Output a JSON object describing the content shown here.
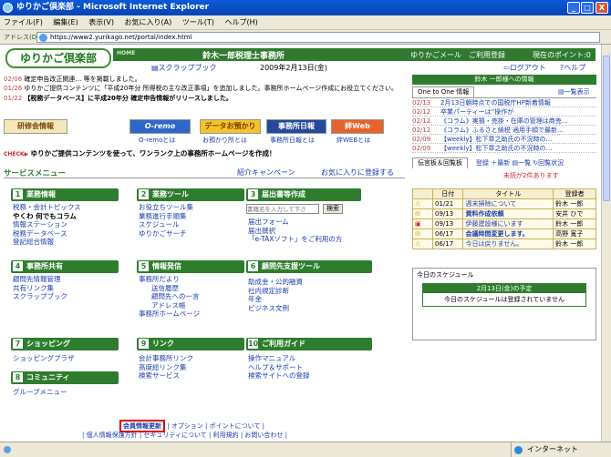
{
  "window": {
    "title": "ゆりかご倶楽部 - Microsoft Internet Explorer",
    "min": "_",
    "max": "□",
    "close": "X"
  },
  "menu": [
    "ファイル(F)",
    "編集(E)",
    "表示(V)",
    "お気に入り(A)",
    "ツール(T)",
    "ヘルプ(H)"
  ],
  "address": {
    "label": "アドレス(D)",
    "url": "https://www2.yurikago.net/portal/index.html"
  },
  "header": {
    "logo": "ゆりかご倶楽部",
    "home": "HOME",
    "office": "鈴木一郎税理士事務所",
    "mail": "ゆりかごメール",
    "entry": "ご利用登録",
    "points": "現在のポイント:0",
    "scrapbook": "スクラップブック",
    "date": "2009年2月13日(金)",
    "logout": "ログアウト",
    "help": "ヘルプ"
  },
  "news": [
    {
      "date": "02/06",
      "text": "確定申告改正関連… 等を掲載しました。"
    },
    {
      "date": "01/26",
      "text": "ゆりかご提供コンテンツに「平成20年分 所得税の主な改正事項」を追加しました。事務所ホームページ作成にお役立てください。"
    },
    {
      "date": "01/22",
      "text": "【税務データベース】に平成20年分 確定申告情報がリリースしました。"
    }
  ],
  "banners": [
    {
      "label": "研修会情報",
      "sub": ""
    },
    {
      "label": "O-remo",
      "sub": "O-remoとは"
    },
    {
      "label": "データお預かり",
      "sub": "お預かり所とは"
    },
    {
      "label": "事務所日報",
      "sub": "事務所日報とは"
    },
    {
      "label": "絆Web",
      "sub": "絆WEBとは"
    }
  ],
  "check_text": "ゆりかご提供コンテンツを使って、ワンランク上の事務所ホームページを作成！",
  "service": {
    "title": "サービスメニュー",
    "campaign": "紹介キャンペーン",
    "favorite": "お気に入りに登録する"
  },
  "categories": [
    {
      "num": "1",
      "title": "業務情報",
      "items": [
        "税務・会計トピックス",
        "やくわ 何でもコラム",
        "情報ステーション",
        "税務データベース",
        "登記総合情報"
      ]
    },
    {
      "num": "2",
      "title": "業務ツール",
      "items": [
        "お役立ちツール集",
        "業務進行手順集",
        "スケジュール",
        "ゆりかごサーチ"
      ]
    },
    {
      "num": "3",
      "title": "届出書等作成",
      "items": [
        "届出フォーム",
        "届出撰択",
        "「e-TAXソフト」をご利用の方"
      ],
      "search_placeholder": "書籍名を入力して下さ",
      "search_button": "検索"
    },
    {
      "num": "4",
      "title": "事務所共有",
      "items": [
        "顧問先情報管理",
        "共有リンク集",
        "スクラップブック"
      ]
    },
    {
      "num": "5",
      "title": "情報発信",
      "items": [
        "事務所だより",
        "送信履歴",
        "顧問先への一言",
        "アドレス帳",
        "事務所ホームページ"
      ]
    },
    {
      "num": "6",
      "title": "顧問先支援ツール",
      "items": [
        "助成金・公的融資",
        "社内規定診断",
        "年金",
        "ビジネス文例"
      ]
    },
    {
      "num": "7",
      "title": "ショッピング",
      "items": [
        "ショッピングプラザ"
      ]
    },
    {
      "num": "8",
      "title": "コミュニティ",
      "items": [
        "グループメニュー"
      ]
    },
    {
      "num": "9",
      "title": "リンク",
      "items": [
        "会計事務所リンク",
        "高度総リンク集",
        "検索サービス"
      ]
    },
    {
      "num": "10",
      "title": "ご利用ガイド",
      "items": [
        "操作マニュアル",
        "ヘルプ＆サポート",
        "検索サイトへの登録"
      ]
    }
  ],
  "footer": {
    "member": "会員情報更新",
    "option": "オプション",
    "points": "ポイントについて",
    "links": [
      "個人情報保護方針",
      "セキュリティについて",
      "利用規約",
      "お問い合わせ"
    ]
  },
  "right": {
    "head": "鈴木 一郎様への情報",
    "oneonone": {
      "tab": "One to One 情報",
      "list_link": "一覧表示",
      "items": [
        {
          "date": "02/13",
          "text": "2月13日朝時点での国税庁HP新着情報"
        },
        {
          "date": "02/12",
          "text": "卒業パーティーは”操作が"
        },
        {
          "date": "02/12",
          "text": "《コラム》実損・売掛・在庫の管理は商売…"
        },
        {
          "date": "02/12",
          "text": "《コラム》ふるさと納税 適用手順で最新…"
        },
        {
          "date": "02/09",
          "text": "【weekly】松下章之助氏の不況時の…"
        },
        {
          "date": "02/09",
          "text": "【weekly】松下章之助氏の不況時の…"
        }
      ]
    },
    "board": {
      "tab": "伝言板＆回覧板",
      "reg": "登録",
      "newest": "最新",
      "list": "一覧",
      "status": "回覧状況",
      "unread": "未読が2件あります",
      "cols": [
        "日付",
        "タイトル",
        "登録者"
      ],
      "rows": [
        {
          "date": "01/21",
          "title": "週末掃除について",
          "author": "鈴木 一郎"
        },
        {
          "date": "09/13",
          "title": "資料作成依頼",
          "author": "安井 ひで"
        },
        {
          "date": "09/13",
          "title": "伊藤建設様にいます",
          "author": "鈴木 一郎"
        },
        {
          "date": "06/17",
          "title": "会議時間変更します。",
          "author": "高野 寛子"
        },
        {
          "date": "06/17",
          "title": "今日は戻りません。",
          "author": "鈴木 一郎"
        }
      ]
    },
    "schedule": {
      "title": "今日のスケジュール",
      "date": "2月13日(金)の予定",
      "empty": "今日のスケジュールは登録されていません"
    }
  },
  "status": {
    "zone": "インターネット"
  }
}
